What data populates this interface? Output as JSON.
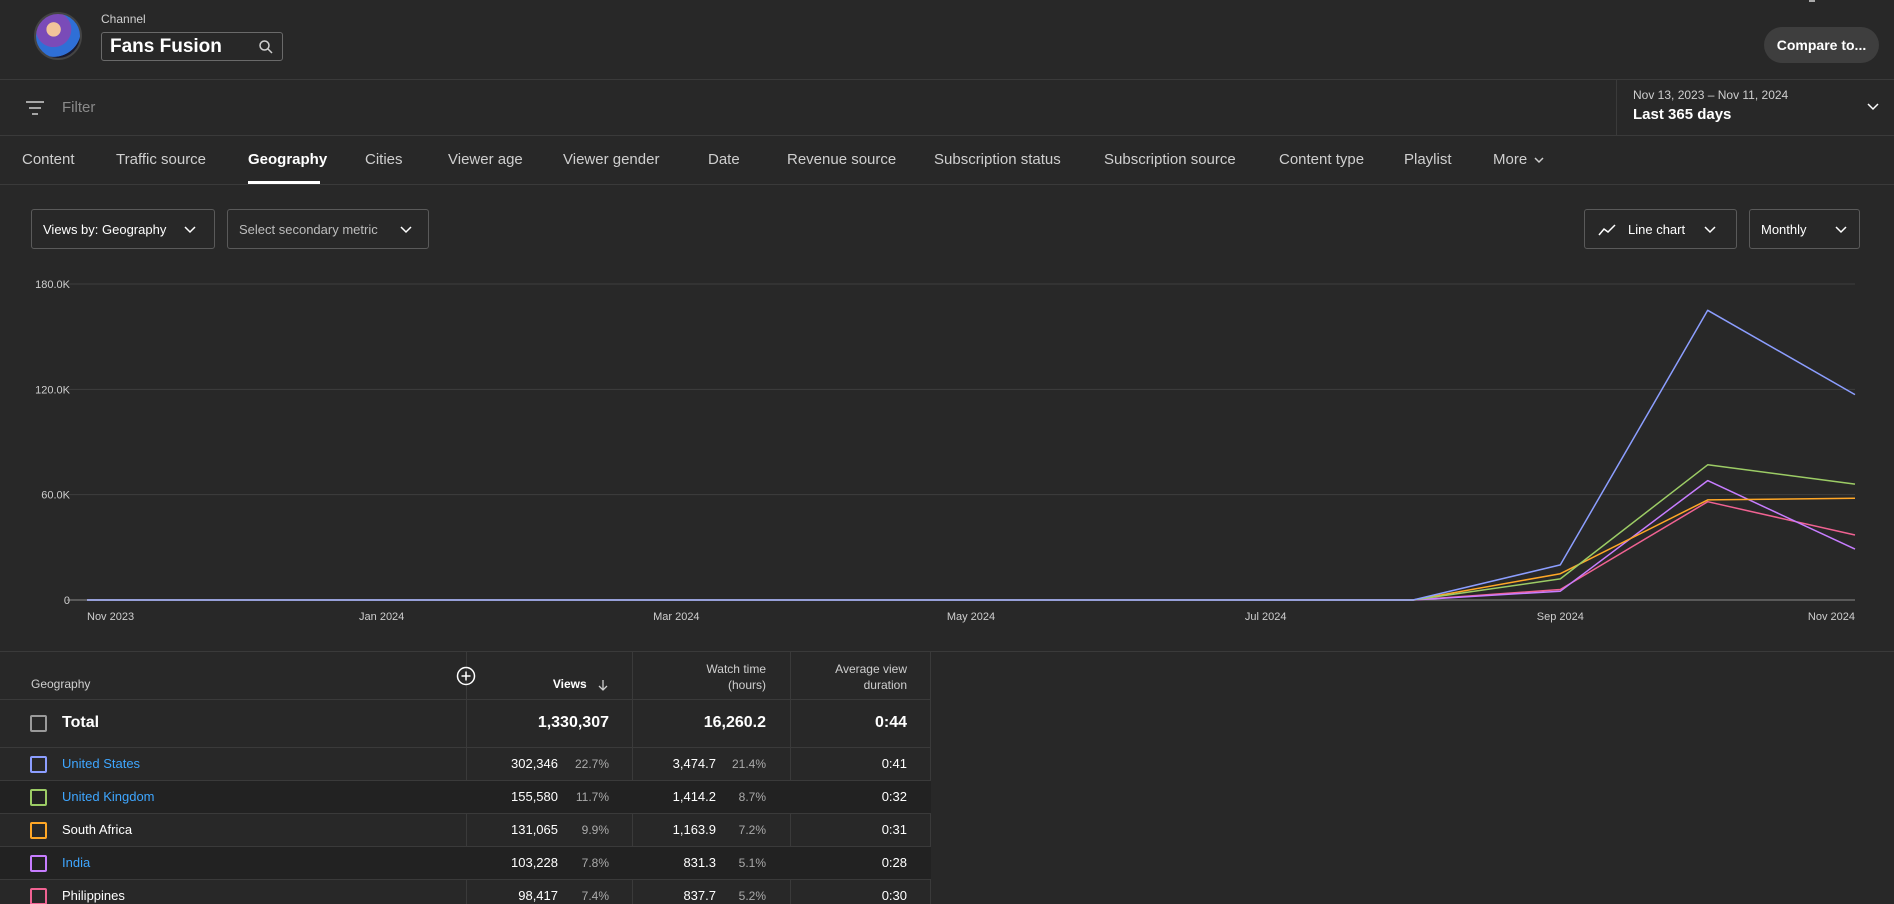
{
  "header": {
    "channel_label": "Channel",
    "channel_name": "Fans Fusion",
    "compare_button": "Compare to..."
  },
  "filter": {
    "placeholder": "Filter",
    "date_range": "Nov 13, 2023 – Nov 11, 2024",
    "date_period": "Last 365 days"
  },
  "tabs": [
    "Content",
    "Traffic source",
    "Geography",
    "Cities",
    "Viewer age",
    "Viewer gender",
    "Date",
    "Revenue source",
    "Subscription status",
    "Subscription source",
    "Content type",
    "Playlist",
    "More"
  ],
  "active_tab": "Geography",
  "controls": {
    "primary_metric": "Views by: Geography",
    "secondary_metric": "Select secondary metric",
    "chart_type": "Line chart",
    "granularity": "Monthly"
  },
  "chart_data": {
    "type": "line",
    "x": [
      "Nov 2023",
      "Dec 2023",
      "Jan 2024",
      "Feb 2024",
      "Mar 2024",
      "Apr 2024",
      "May 2024",
      "Jun 2024",
      "Jul 2024",
      "Aug 2024",
      "Sep 2024",
      "Oct 2024",
      "Nov 2024"
    ],
    "x_tick_labels": [
      "Nov 2023",
      "Jan 2024",
      "Mar 2024",
      "May 2024",
      "Jul 2024",
      "Sep 2024",
      "Nov 2024"
    ],
    "y_tick_labels": [
      "0",
      "60.0K",
      "120.0K",
      "180.0K"
    ],
    "ylim": [
      0,
      180000
    ],
    "grid": true,
    "series": [
      {
        "name": "United States",
        "color": "#8c9eff",
        "values": [
          0,
          0,
          0,
          0,
          0,
          0,
          0,
          0,
          0,
          0,
          20000,
          165000,
          117000
        ]
      },
      {
        "name": "United Kingdom",
        "color": "#9ccc65",
        "values": [
          0,
          0,
          0,
          0,
          0,
          0,
          0,
          0,
          0,
          0,
          12000,
          77000,
          66000
        ]
      },
      {
        "name": "South Africa",
        "color": "#ffa726",
        "values": [
          0,
          0,
          0,
          0,
          0,
          0,
          0,
          0,
          0,
          0,
          15000,
          57000,
          58000
        ]
      },
      {
        "name": "India",
        "color": "#c77dff",
        "values": [
          0,
          0,
          0,
          0,
          0,
          0,
          0,
          0,
          0,
          0,
          5000,
          68000,
          29000
        ]
      },
      {
        "name": "Philippines",
        "color": "#f06292",
        "values": [
          0,
          0,
          0,
          0,
          0,
          0,
          0,
          0,
          0,
          0,
          6000,
          56000,
          37000
        ]
      }
    ]
  },
  "table": {
    "headers": {
      "geography": "Geography",
      "views": "Views",
      "watch_time_1": "Watch time",
      "watch_time_2": "(hours)",
      "avd_1": "Average view",
      "avd_2": "duration"
    },
    "total": {
      "label": "Total",
      "views": "1,330,307",
      "watch_time": "16,260.2",
      "avd": "0:44"
    },
    "rows": [
      {
        "name": "United States",
        "views": "302,346",
        "views_pct": "22.7%",
        "watch_time": "3,474.7",
        "watch_pct": "21.4%",
        "avd": "0:41",
        "color": "#8c9eff",
        "link": true
      },
      {
        "name": "United Kingdom",
        "views": "155,580",
        "views_pct": "11.7%",
        "watch_time": "1,414.2",
        "watch_pct": "8.7%",
        "avd": "0:32",
        "color": "#9ccc65",
        "link": true
      },
      {
        "name": "South Africa",
        "views": "131,065",
        "views_pct": "9.9%",
        "watch_time": "1,163.9",
        "watch_pct": "7.2%",
        "avd": "0:31",
        "color": "#ffa726",
        "link": false
      },
      {
        "name": "India",
        "views": "103,228",
        "views_pct": "7.8%",
        "watch_time": "831.3",
        "watch_pct": "5.1%",
        "avd": "0:28",
        "color": "#c77dff",
        "link": true
      },
      {
        "name": "Philippines",
        "views": "98,417",
        "views_pct": "7.4%",
        "watch_time": "837.7",
        "watch_pct": "5.2%",
        "avd": "0:30",
        "color": "#f06292",
        "link": false
      }
    ]
  }
}
